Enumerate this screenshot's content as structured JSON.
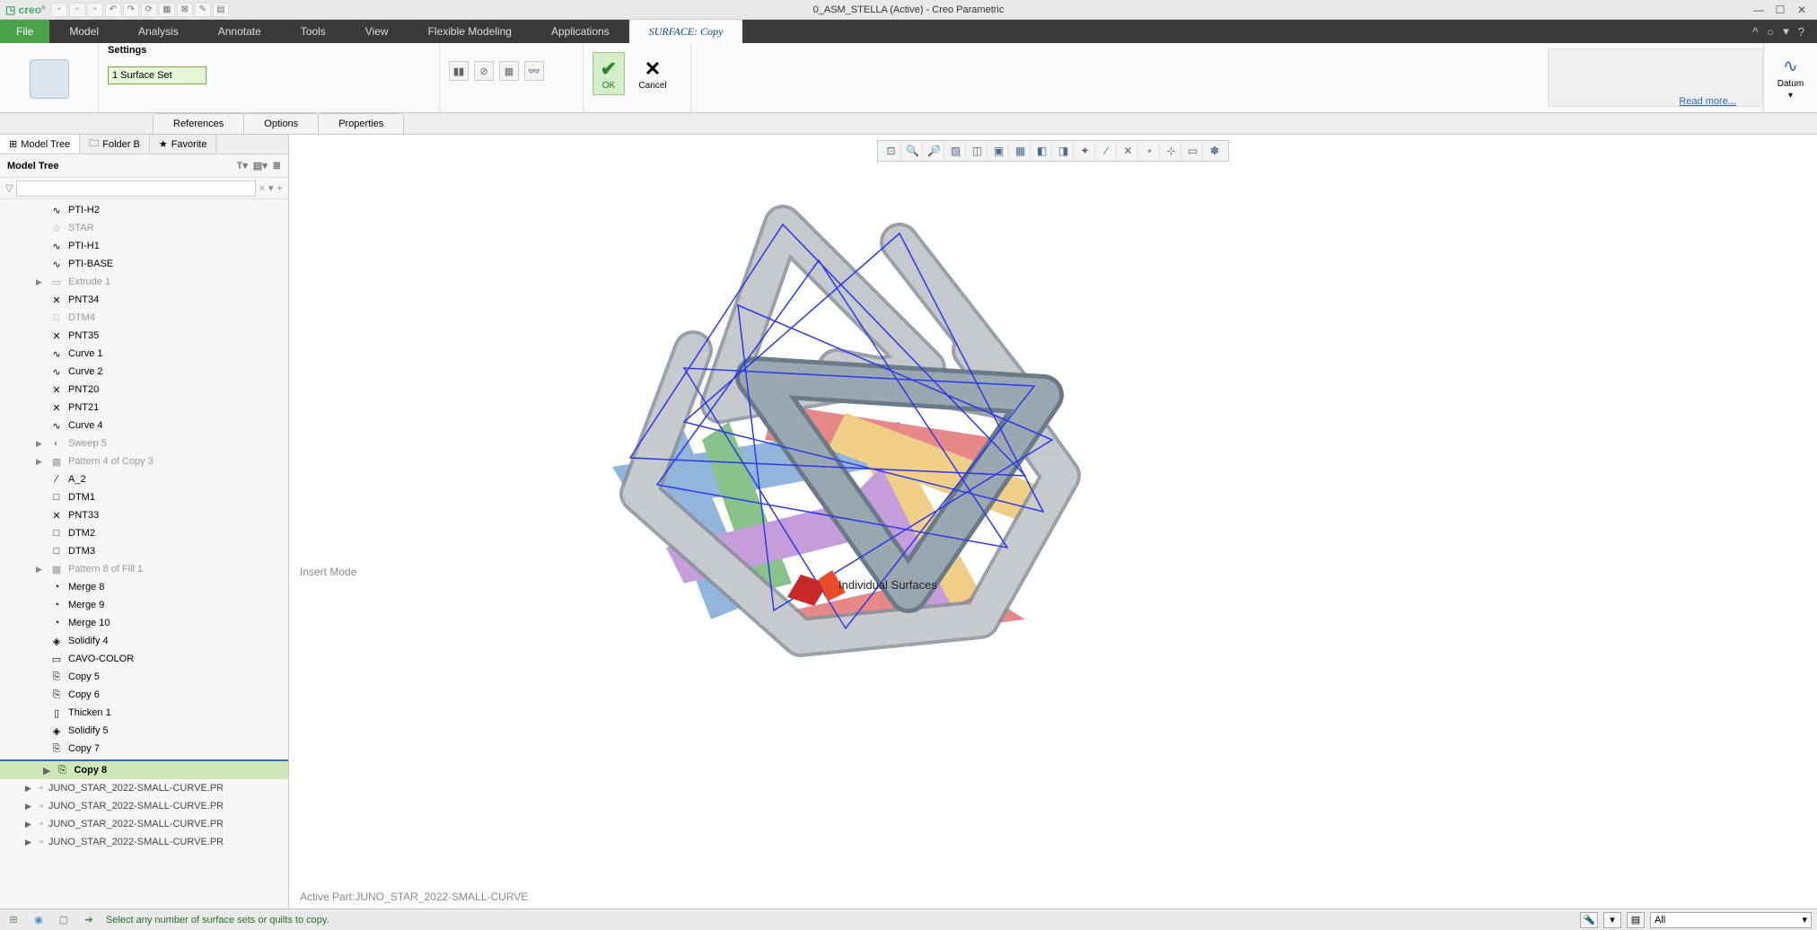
{
  "title": "0_ASM_STELLA (Active) - Creo Parametric",
  "app_name": "creo",
  "menus": {
    "file": "File",
    "tabs": [
      "Model",
      "Analysis",
      "Annotate",
      "Tools",
      "View",
      "Flexible Modeling",
      "Applications"
    ],
    "active_tab": "SURFACE: Copy"
  },
  "ribbon": {
    "settings_label": "Settings",
    "surface_input": "1 Surface Set",
    "ok": "OK",
    "cancel": "Cancel",
    "read_more": "Read more...",
    "datum": "Datum",
    "subtabs": [
      "References",
      "Options",
      "Properties"
    ]
  },
  "tree": {
    "tabs": {
      "model": "Model Tree",
      "folder": "Folder B",
      "fav": "Favorite"
    },
    "header": "Model Tree",
    "filter_placeholder": "",
    "items": [
      {
        "label": "PTI-H2",
        "icon": "∿",
        "dim": false
      },
      {
        "label": "STAR",
        "icon": "☆",
        "dim": true
      },
      {
        "label": "PTI-H1",
        "icon": "∿",
        "dim": false
      },
      {
        "label": "PTI-BASE",
        "icon": "∿",
        "dim": false
      },
      {
        "label": "Extrude 1",
        "icon": "▭",
        "dim": true,
        "exp": true
      },
      {
        "label": "PNT34",
        "icon": "✕",
        "dim": false
      },
      {
        "label": "DTM4",
        "icon": "□",
        "dim": true
      },
      {
        "label": "PNT35",
        "icon": "✕",
        "dim": false
      },
      {
        "label": "Curve 1",
        "icon": "∿",
        "dim": false
      },
      {
        "label": "Curve 2",
        "icon": "∿",
        "dim": false
      },
      {
        "label": "PNT20",
        "icon": "✕",
        "dim": false
      },
      {
        "label": "PNT21",
        "icon": "✕",
        "dim": false
      },
      {
        "label": "Curve 4",
        "icon": "∿",
        "dim": false
      },
      {
        "label": "Sweep 5",
        "icon": "◐",
        "dim": true,
        "exp": true
      },
      {
        "label": "Pattern 4 of Copy 3",
        "icon": "▦",
        "dim": true,
        "exp": true
      },
      {
        "label": "A_2",
        "icon": "∕",
        "dim": false
      },
      {
        "label": "DTM1",
        "icon": "□",
        "dim": false
      },
      {
        "label": "PNT33",
        "icon": "✕",
        "dim": false
      },
      {
        "label": "DTM2",
        "icon": "□",
        "dim": false
      },
      {
        "label": "DTM3",
        "icon": "□",
        "dim": false
      },
      {
        "label": "Pattern 8 of Fill 1",
        "icon": "▦",
        "dim": true,
        "exp": true
      },
      {
        "label": "Merge 8",
        "icon": "◔",
        "dim": false
      },
      {
        "label": "Merge 9",
        "icon": "◔",
        "dim": false
      },
      {
        "label": "Merge 10",
        "icon": "◔",
        "dim": false
      },
      {
        "label": "Solidify 4",
        "icon": "◈",
        "dim": false
      },
      {
        "label": "CAVO-COLOR",
        "icon": "▭",
        "dim": false
      },
      {
        "label": "Copy 5",
        "icon": "⎘",
        "dim": false
      },
      {
        "label": "Copy 6",
        "icon": "⎘",
        "dim": false
      },
      {
        "label": "Thicken 1",
        "icon": "▯",
        "dim": false
      },
      {
        "label": "Solidify 5",
        "icon": "◈",
        "dim": false
      },
      {
        "label": "Copy 7",
        "icon": "⎘",
        "dim": false
      }
    ],
    "active_item": {
      "label": "Copy 8",
      "icon": "⎘"
    },
    "asm_items": [
      "JUNO_STAR_2022-SMALL-CURVE.PR",
      "JUNO_STAR_2022-SMALL-CURVE.PR",
      "JUNO_STAR_2022-SMALL-CURVE.PR",
      "JUNO_STAR_2022-SMALL-CURVE.PR"
    ]
  },
  "viewport": {
    "insert_mode": "Insert Mode",
    "active_part": "Active Part:JUNO_STAR_2022-SMALL-CURVE",
    "surface_label": "Individual Surfaces"
  },
  "status": {
    "message": "Select any number of surface sets or quilts to copy.",
    "filter": "All"
  }
}
